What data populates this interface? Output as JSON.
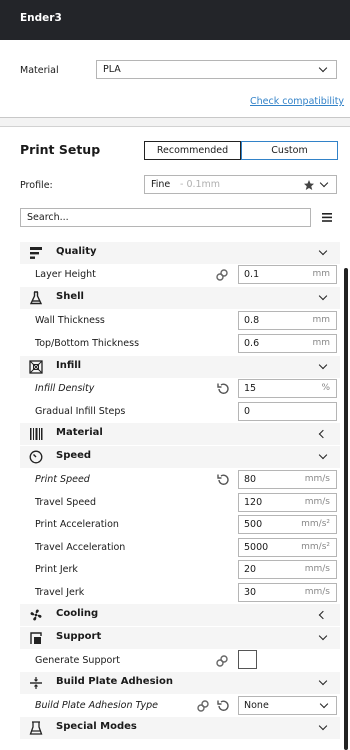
{
  "header": {
    "title": "Ender3"
  },
  "material": {
    "label": "Material",
    "value": "PLA",
    "check_link": "Check compatibility"
  },
  "print_setup": {
    "title": "Print Setup",
    "tabs": [
      {
        "label": "Recommended",
        "active": false
      },
      {
        "label": "Custom",
        "active": true
      }
    ],
    "profile_label": "Profile:",
    "profile_value": "Fine",
    "profile_suffix": "- 0.1mm",
    "search_value": "Search..."
  },
  "sections": {
    "quality": "Quality",
    "shell": "Shell",
    "infill": "Infill",
    "material": "Material",
    "speed": "Speed",
    "cooling": "Cooling",
    "support": "Support",
    "adhesion": "Build Plate Adhesion",
    "special": "Special Modes"
  },
  "settings": {
    "layer_height": {
      "name": "Layer Height",
      "value": "0.1",
      "unit": "mm"
    },
    "wall_thickness": {
      "name": "Wall Thickness",
      "value": "0.8",
      "unit": "mm"
    },
    "top_bottom": {
      "name": "Top/Bottom Thickness",
      "value": "0.6",
      "unit": "mm"
    },
    "infill_density": {
      "name": "Infill Density",
      "value": "15",
      "unit": "%"
    },
    "gradual_infill": {
      "name": "Gradual Infill Steps",
      "value": "0"
    },
    "print_speed": {
      "name": "Print Speed",
      "value": "80",
      "unit": "mm/s"
    },
    "travel_speed": {
      "name": "Travel Speed",
      "value": "120",
      "unit": "mm/s"
    },
    "print_accel": {
      "name": "Print Acceleration",
      "value": "500",
      "unit": "mm/s²"
    },
    "travel_accel": {
      "name": "Travel Acceleration",
      "value": "5000",
      "unit": "mm/s²"
    },
    "print_jerk": {
      "name": "Print Jerk",
      "value": "20",
      "unit": "mm/s"
    },
    "travel_jerk": {
      "name": "Travel Jerk",
      "value": "30",
      "unit": "mm/s"
    },
    "generate_support": {
      "name": "Generate Support",
      "checked": false
    },
    "adhesion_type": {
      "name": "Build Plate Adhesion Type",
      "value": "None"
    }
  },
  "colors": {
    "accent": "#3282c8",
    "header_bg": "#232529"
  }
}
